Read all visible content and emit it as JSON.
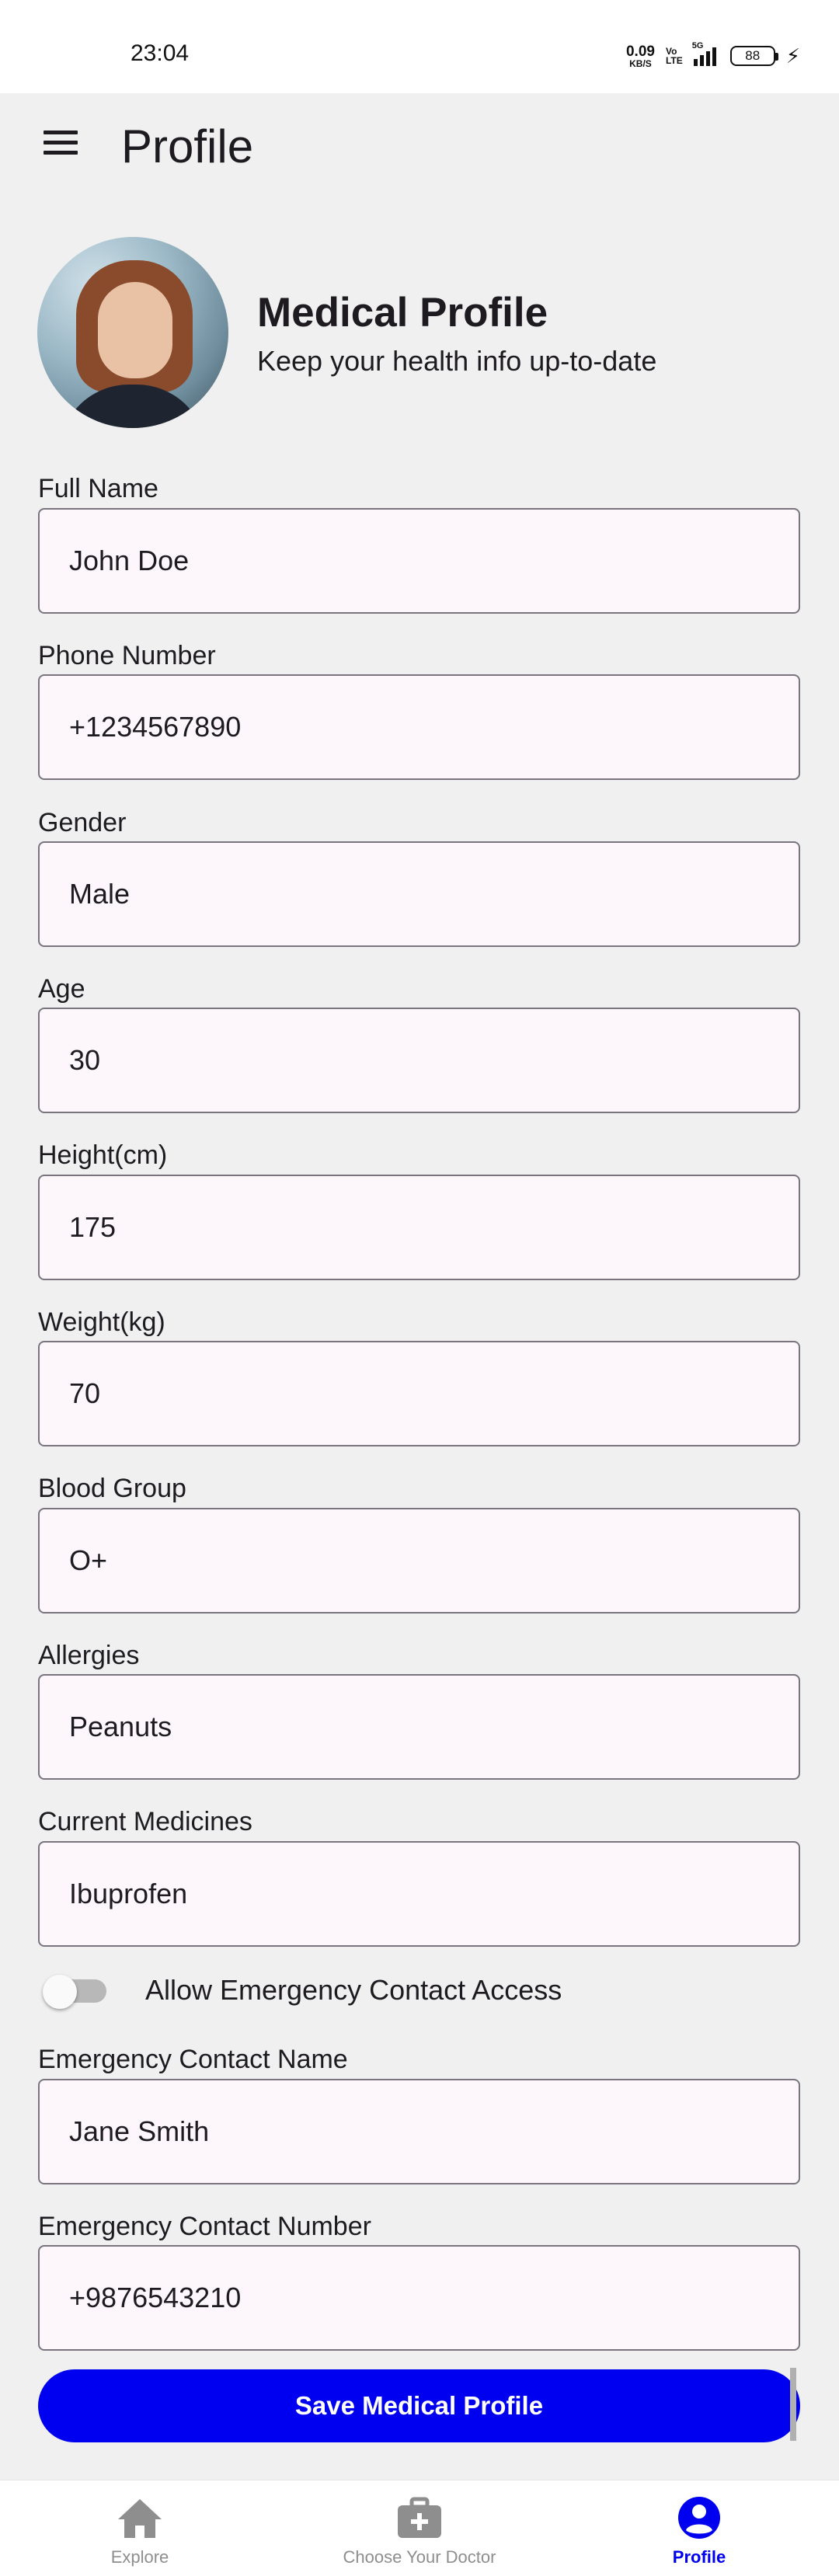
{
  "status_bar": {
    "time": "23:04",
    "net_speed_value": "0.09",
    "net_speed_unit": "KB/S",
    "volte_top": "Vo",
    "volte_bottom": "LTE",
    "network": "5G",
    "battery": "88"
  },
  "app_bar": {
    "title": "Profile",
    "menu_icon": "hamburger-menu-icon"
  },
  "header": {
    "title": "Medical Profile",
    "subtitle": "Keep your health info up-to-date"
  },
  "fields": [
    {
      "label": "Full Name",
      "value": "John Doe"
    },
    {
      "label": "Phone Number",
      "value": "+1234567890"
    },
    {
      "label": "Gender",
      "value": "Male"
    },
    {
      "label": "Age",
      "value": "30"
    },
    {
      "label": "Height(cm)",
      "value": "175"
    },
    {
      "label": "Weight(kg)",
      "value": "70"
    },
    {
      "label": "Blood Group",
      "value": "O+"
    },
    {
      "label": "Allergies",
      "value": "Peanuts"
    },
    {
      "label": "Current Medicines",
      "value": "Ibuprofen"
    }
  ],
  "emergency_toggle": {
    "label": "Allow Emergency Contact Access",
    "enabled": false
  },
  "emergency_fields": [
    {
      "label": "Emergency Contact Name",
      "value": "Jane Smith"
    },
    {
      "label": "Emergency Contact Number",
      "value": "+9876543210"
    }
  ],
  "save_button": "Save Medical Profile",
  "bottom_nav": [
    {
      "label": "Explore",
      "icon": "home-icon",
      "active": false
    },
    {
      "label": "Choose Your Doctor",
      "icon": "medical-kit-icon",
      "active": false
    },
    {
      "label": "Profile",
      "icon": "user-circle-icon",
      "active": true
    }
  ],
  "colors": {
    "accent": "#0000f0",
    "field_background": "#fdf7fc",
    "field_border": "#79747e",
    "page_background": "#f0f0f0"
  }
}
